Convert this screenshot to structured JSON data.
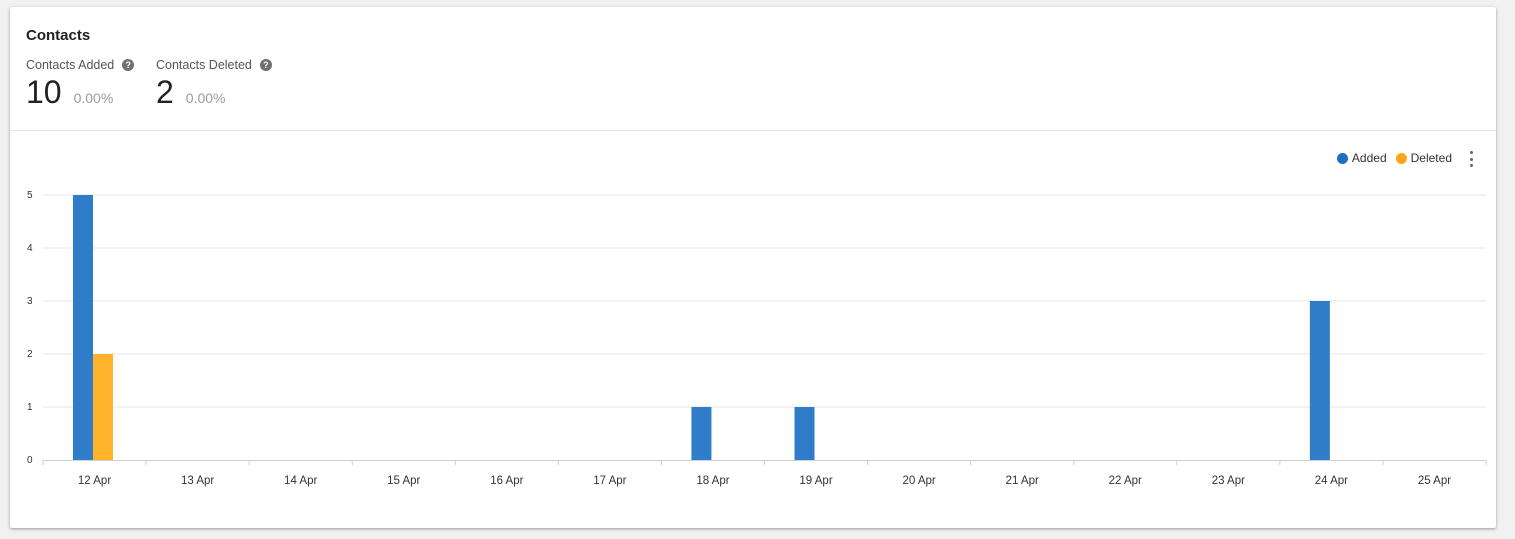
{
  "card": {
    "title": "Contacts"
  },
  "stats": [
    {
      "label": "Contacts Added",
      "value": "10",
      "change": "0.00%"
    },
    {
      "label": "Contacts Deleted",
      "value": "2",
      "change": "0.00%"
    }
  ],
  "icons": {
    "help": "help-icon",
    "menu": "more-vert-icon"
  },
  "legend": {
    "added_label": "Added",
    "deleted_label": "Deleted"
  },
  "colors": {
    "added": "#2f7cc9",
    "deleted": "#ffb32b",
    "legend_added": "#1f6fc1",
    "legend_deleted": "#ffa51a",
    "grid": "#e6e6e6",
    "axis": "#cfcfcf"
  },
  "chart_data": {
    "type": "bar",
    "categories": [
      "12 Apr",
      "13 Apr",
      "14 Apr",
      "15 Apr",
      "16 Apr",
      "17 Apr",
      "18 Apr",
      "19 Apr",
      "20 Apr",
      "21 Apr",
      "22 Apr",
      "23 Apr",
      "24 Apr",
      "25 Apr"
    ],
    "series": [
      {
        "name": "Added",
        "values": [
          5,
          0,
          0,
          0,
          0,
          0,
          1,
          1,
          0,
          0,
          0,
          0,
          3,
          0
        ]
      },
      {
        "name": "Deleted",
        "values": [
          2,
          0,
          0,
          0,
          0,
          0,
          0,
          0,
          0,
          0,
          0,
          0,
          0,
          0
        ]
      }
    ],
    "ylim": [
      0,
      5
    ],
    "yticks": [
      0,
      1,
      2,
      3,
      4,
      5
    ],
    "grid": true,
    "legend_position": "top-right"
  }
}
